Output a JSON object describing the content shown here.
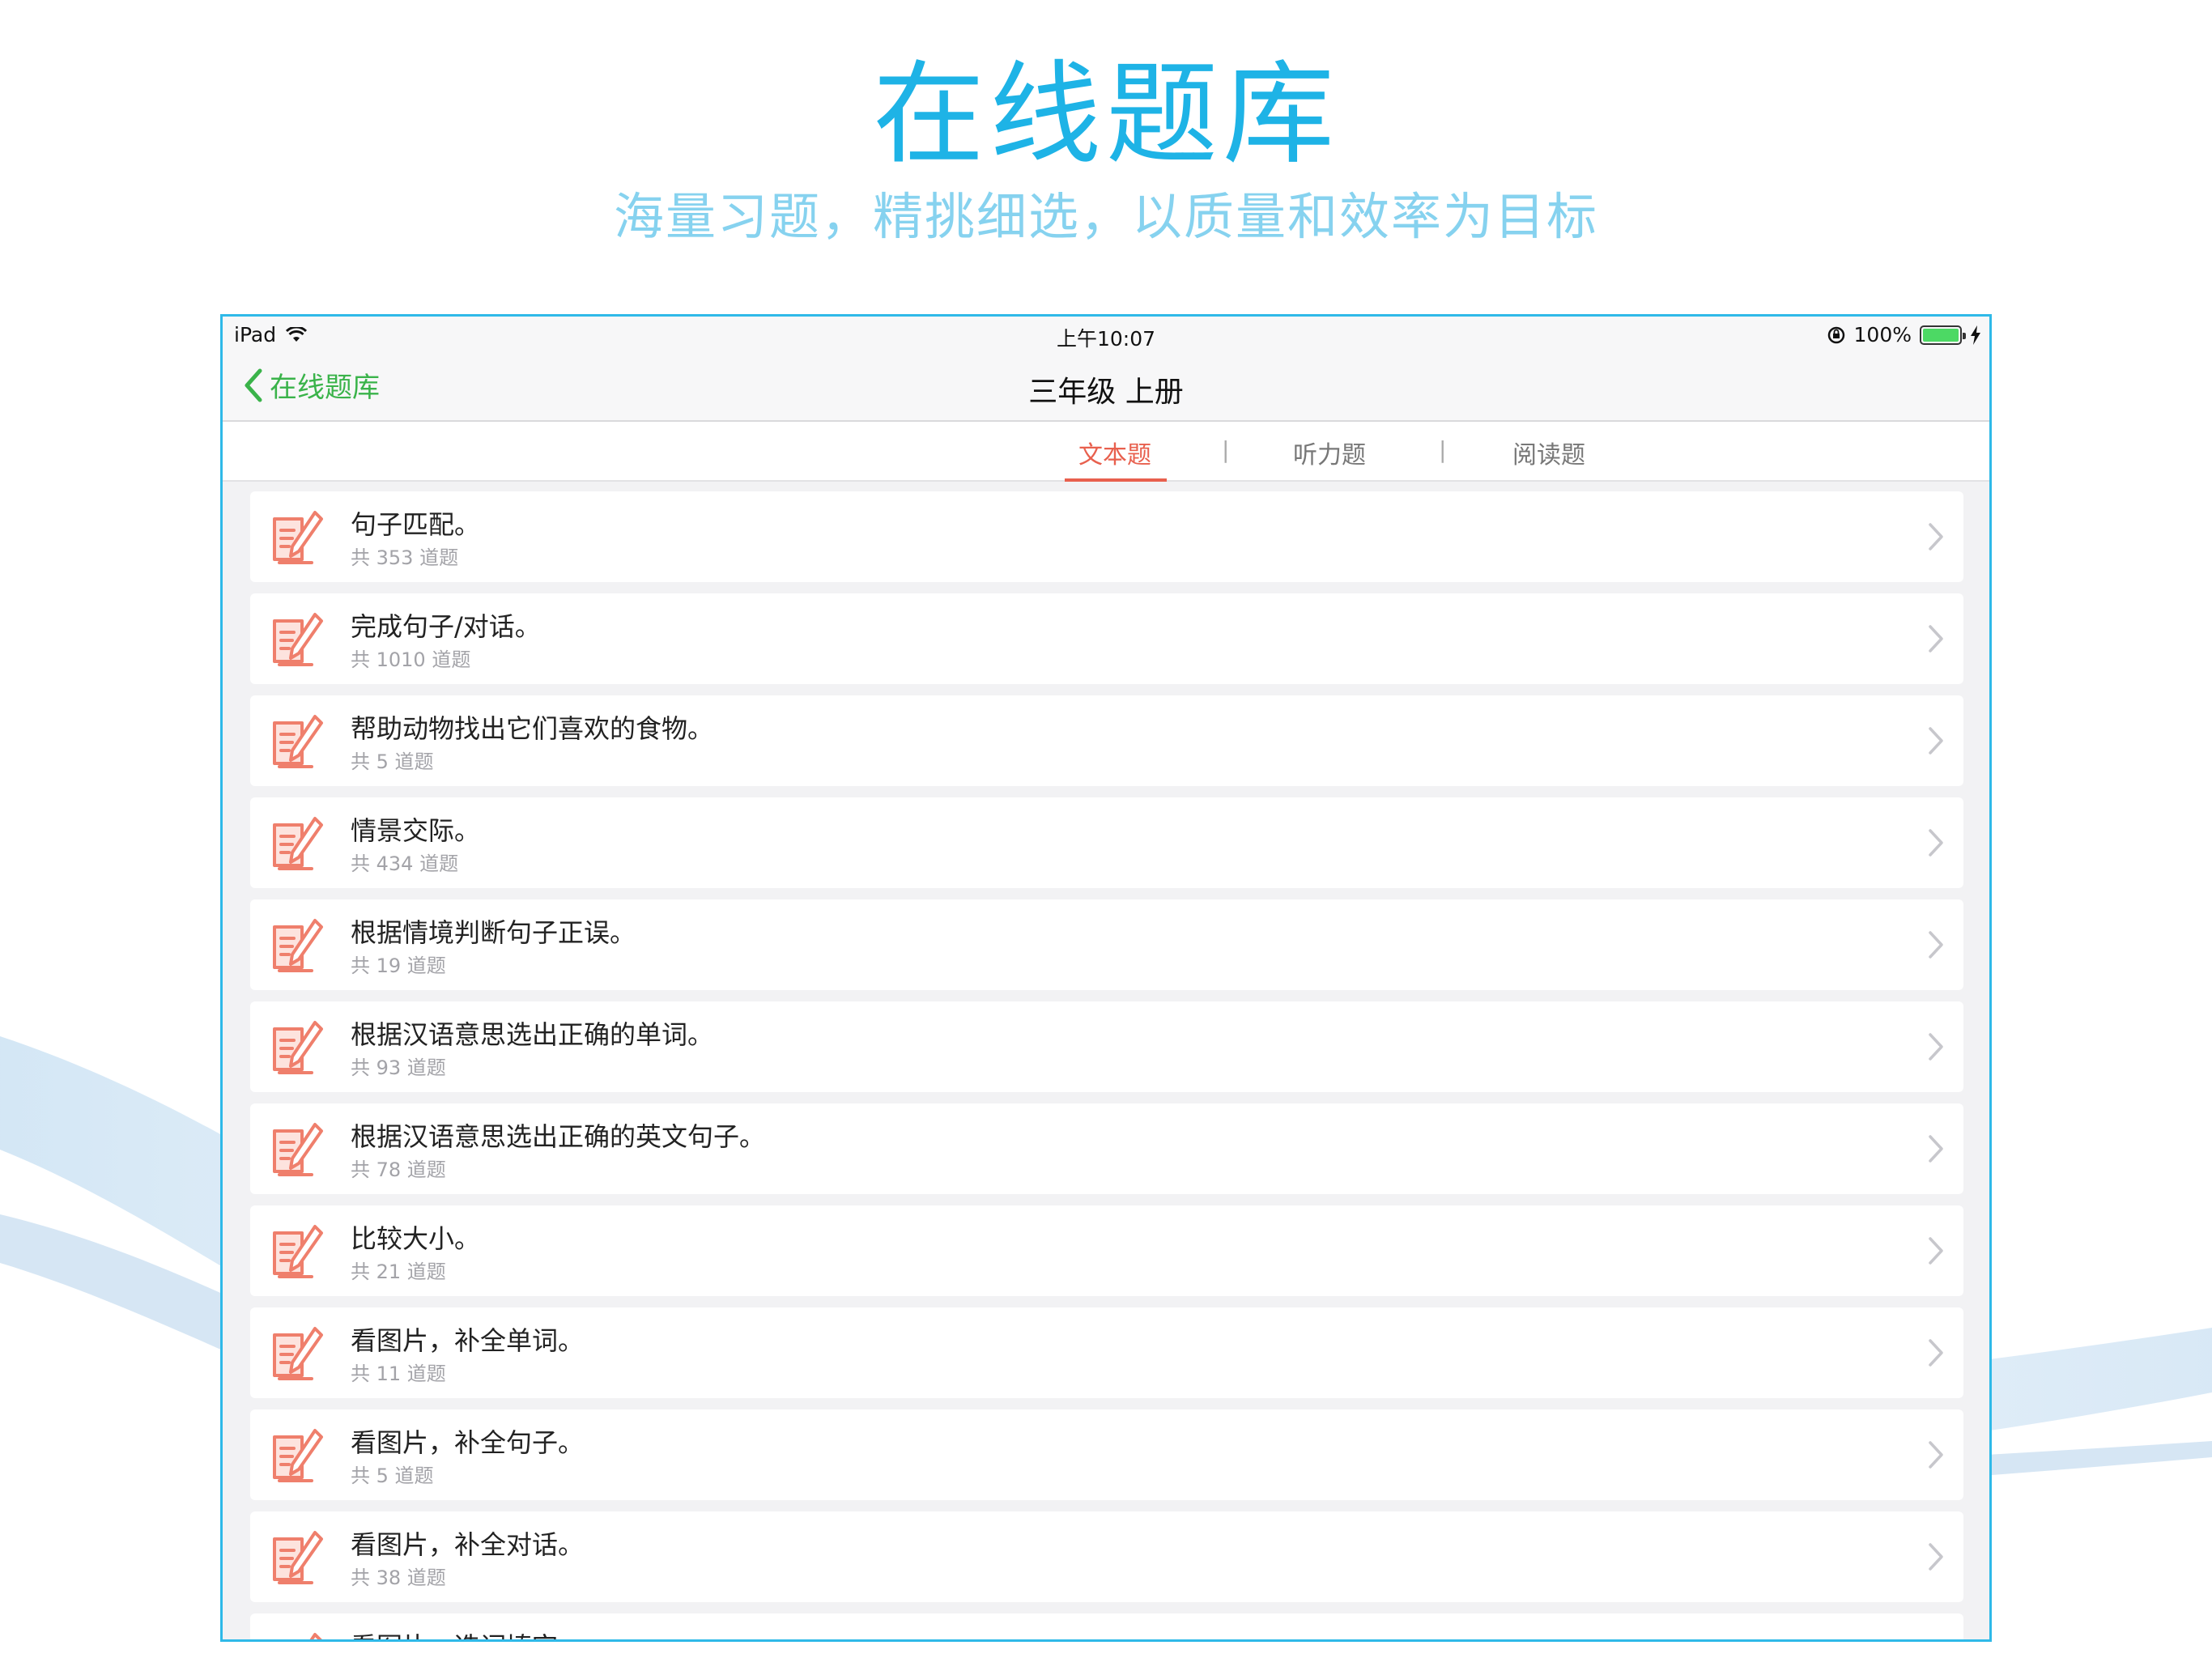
{
  "hero": {
    "title": "在线题库",
    "subtitle": "海量习题，精挑细选，以质量和效率为目标"
  },
  "status_bar": {
    "device": "iPad",
    "time": "上午10:07",
    "battery": "100%",
    "battery_level": 1.0
  },
  "nav": {
    "back_label": "在线题库",
    "title": "三年级 上册"
  },
  "tabs": [
    {
      "label": "文本题",
      "active": true
    },
    {
      "label": "听力题",
      "active": false
    },
    {
      "label": "阅读题",
      "active": false
    }
  ],
  "tab_separator": "|",
  "items": [
    {
      "title": "句子匹配。",
      "count": "共 353 道题"
    },
    {
      "title": "完成句子/对话。",
      "count": "共 1010 道题"
    },
    {
      "title": "帮助动物找出它们喜欢的食物。",
      "count": "共 5 道题"
    },
    {
      "title": "情景交际。",
      "count": "共 434 道题"
    },
    {
      "title": "根据情境判断句子正误。",
      "count": "共 19 道题"
    },
    {
      "title": "根据汉语意思选出正确的单词。",
      "count": "共 93 道题"
    },
    {
      "title": "根据汉语意思选出正确的英文句子。",
      "count": "共 78 道题"
    },
    {
      "title": "比较大小。",
      "count": "共 21 道题"
    },
    {
      "title": "看图片，补全单词。",
      "count": "共 11 道题"
    },
    {
      "title": "看图片，补全句子。",
      "count": "共 5 道题"
    },
    {
      "title": "看图片，补全对话。",
      "count": "共 38 道题"
    },
    {
      "title": "看图片，选词填空",
      "count": ""
    }
  ],
  "colors": {
    "accent_blue": "#1eb3e6",
    "nav_green": "#3ab34a",
    "tab_active": "#e8604e",
    "icon_red": "#ef7f6c"
  }
}
